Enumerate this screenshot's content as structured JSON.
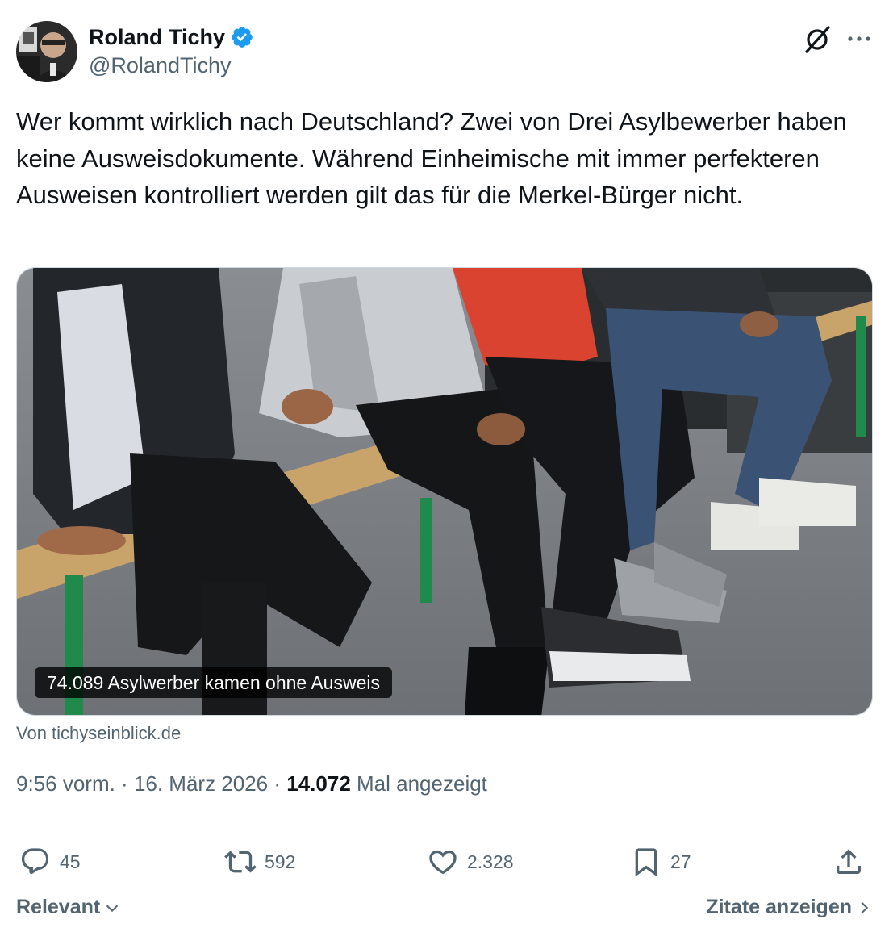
{
  "author": {
    "display_name": "Roland Tichy",
    "handle": "@RolandTichy",
    "verified_icon": "verified-badge-icon"
  },
  "header_icons": [
    "grok-icon",
    "more-icon"
  ],
  "tweet": {
    "text": "Wer kommt wirklich nach Deutschland? Zwei von Drei Asylbewerber haben keine Ausweisdokumente. Während Einheimische mit immer perfekteren Ausweisen kontrolliert werden gilt das für die Merkel-Bürger nicht."
  },
  "card": {
    "caption": "74.089 Asylwerber kamen ohne Ausweis",
    "source": "Von tichyseinblick.de"
  },
  "meta": {
    "time": "9:56 vorm.",
    "separator": " · ",
    "date": "16. März 2026",
    "views_count": "14.072",
    "views_label": " Mal angezeigt"
  },
  "actions": {
    "replies": "45",
    "reposts": "592",
    "likes": "2.328",
    "bookmarks": "27"
  },
  "footer": {
    "sort_label": "Relevant",
    "quotes_label": "Zitate anzeigen"
  },
  "colors": {
    "verified": "#1d9bf0",
    "secondary_text": "#536471",
    "primary_text": "#0f1419"
  }
}
